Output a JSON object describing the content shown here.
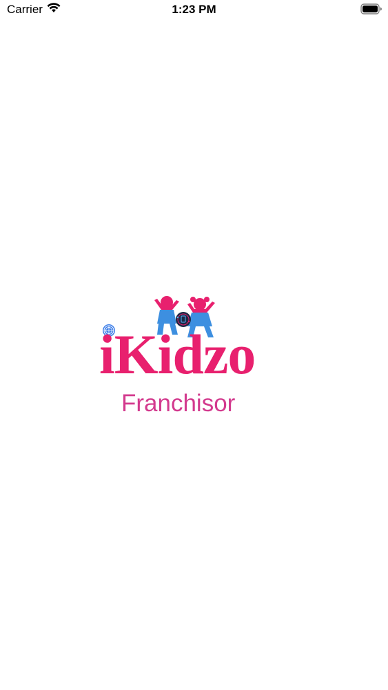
{
  "status_bar": {
    "carrier": "Carrier",
    "time": "1:23 PM",
    "wifi_icon": "wifi-icon",
    "battery_icon": "battery-icon"
  },
  "splash": {
    "brand_name": "iKidzo",
    "subtitle": "Franchisor",
    "logo_icon": "kids-logo-icon",
    "colors": {
      "brand_pink": "#e8206e",
      "subtitle_pink": "#d33a8e",
      "kid_blue": "#3d8fe0"
    }
  }
}
